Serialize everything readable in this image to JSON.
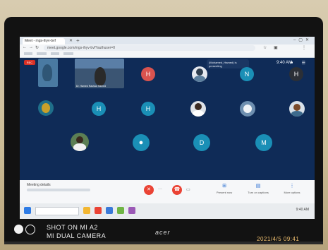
{
  "browser": {
    "tab_title": "Meet - mgs-ihyv-bvf",
    "url": "meet.google.com/mgs-ihyv-bvf?authuser=0"
  },
  "meet": {
    "presenting_label": "(Mohamed_Hamed) is presenting",
    "record_label": "REC",
    "clock": "9:40 AM",
    "presenter_caption": "Dr. Hamed Rashad Hamed",
    "avatars": [
      "H",
      "N",
      "H",
      "H",
      "H",
      "D",
      "M"
    ],
    "colors": {
      "background": "#0f2b57",
      "avatar_red": "#d9534f",
      "avatar_teal": "#1a8fb6",
      "avatar_dark": "#2b2f36",
      "end_call": "#ea4335"
    }
  },
  "controls": {
    "meeting_details": "Meeting details",
    "present": "Present now",
    "captions": "Turn on captions",
    "more": "More options"
  },
  "device": {
    "brand": "acer"
  },
  "photo": {
    "watermark_line1": "SHOT ON MI A2",
    "watermark_line2": "MI DUAL CAMERA",
    "timestamp": "2021/4/5  09:41"
  }
}
